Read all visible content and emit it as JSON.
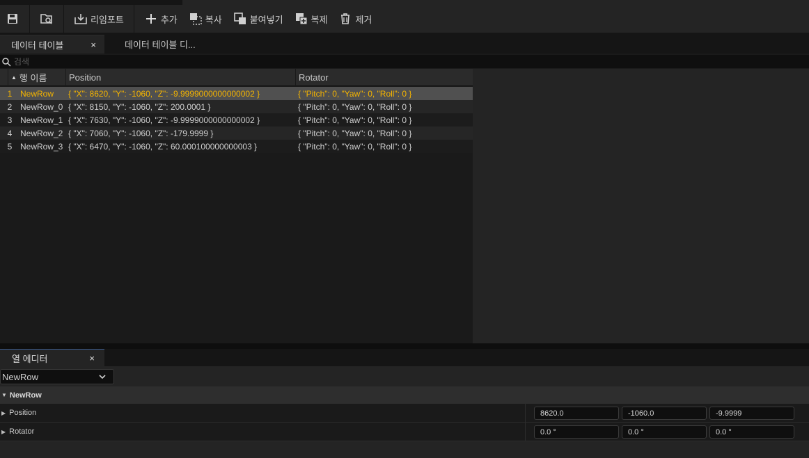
{
  "toolbar": {
    "save_icon": "save-icon",
    "browse_icon": "browse-icon",
    "reimport_label": "리임포트",
    "add_label": "추가",
    "copy_label": "복사",
    "paste_label": "붙여넣기",
    "duplicate_label": "복제",
    "remove_label": "제거"
  },
  "tabs": {
    "data_table": "데이터 테이블",
    "data_table_diff": "데이터 테이블 디...",
    "close_glyph": "×"
  },
  "search": {
    "placeholder": "검색"
  },
  "table": {
    "columns": [
      "행 이름",
      "Position",
      "Rotator"
    ],
    "selected_index": 0,
    "rows": [
      {
        "index": "1",
        "name": "NewRow",
        "position": "{ \"X\": 8620, \"Y\": -1060, \"Z\": -9.9999000000000002 }",
        "rotator": "{ \"Pitch\": 0, \"Yaw\": 0, \"Roll\": 0 }"
      },
      {
        "index": "2",
        "name": "NewRow_0",
        "position": "{ \"X\": 8150, \"Y\": -1060, \"Z\": 200.0001 }",
        "rotator": "{ \"Pitch\": 0, \"Yaw\": 0, \"Roll\": 0 }"
      },
      {
        "index": "3",
        "name": "NewRow_1",
        "position": "{ \"X\": 7630, \"Y\": -1060, \"Z\": -9.9999000000000002 }",
        "rotator": "{ \"Pitch\": 0, \"Yaw\": 0, \"Roll\": 0 }"
      },
      {
        "index": "4",
        "name": "NewRow_2",
        "position": "{ \"X\": 7060, \"Y\": -1060, \"Z\": -179.9999 }",
        "rotator": "{ \"Pitch\": 0, \"Yaw\": 0, \"Roll\": 0 }"
      },
      {
        "index": "5",
        "name": "NewRow_3",
        "position": "{ \"X\": 6470, \"Y\": -1060, \"Z\": 60.000100000000003 }",
        "rotator": "{ \"Pitch\": 0, \"Yaw\": 0, \"Roll\": 0 }"
      }
    ]
  },
  "row_editor": {
    "tab_label": "열 에디터",
    "selected_row": "NewRow",
    "category": "NewRow",
    "properties": [
      {
        "label": "Position",
        "values": [
          "8620.0",
          "-1060.0",
          "-9.9999"
        ]
      },
      {
        "label": "Rotator",
        "values": [
          "0.0 °",
          "0.0 °",
          "0.0 °"
        ]
      }
    ]
  },
  "colors": {
    "selected_text": "#f4b400",
    "selected_row_bg": "#505050",
    "panel_bg": "#242424"
  }
}
